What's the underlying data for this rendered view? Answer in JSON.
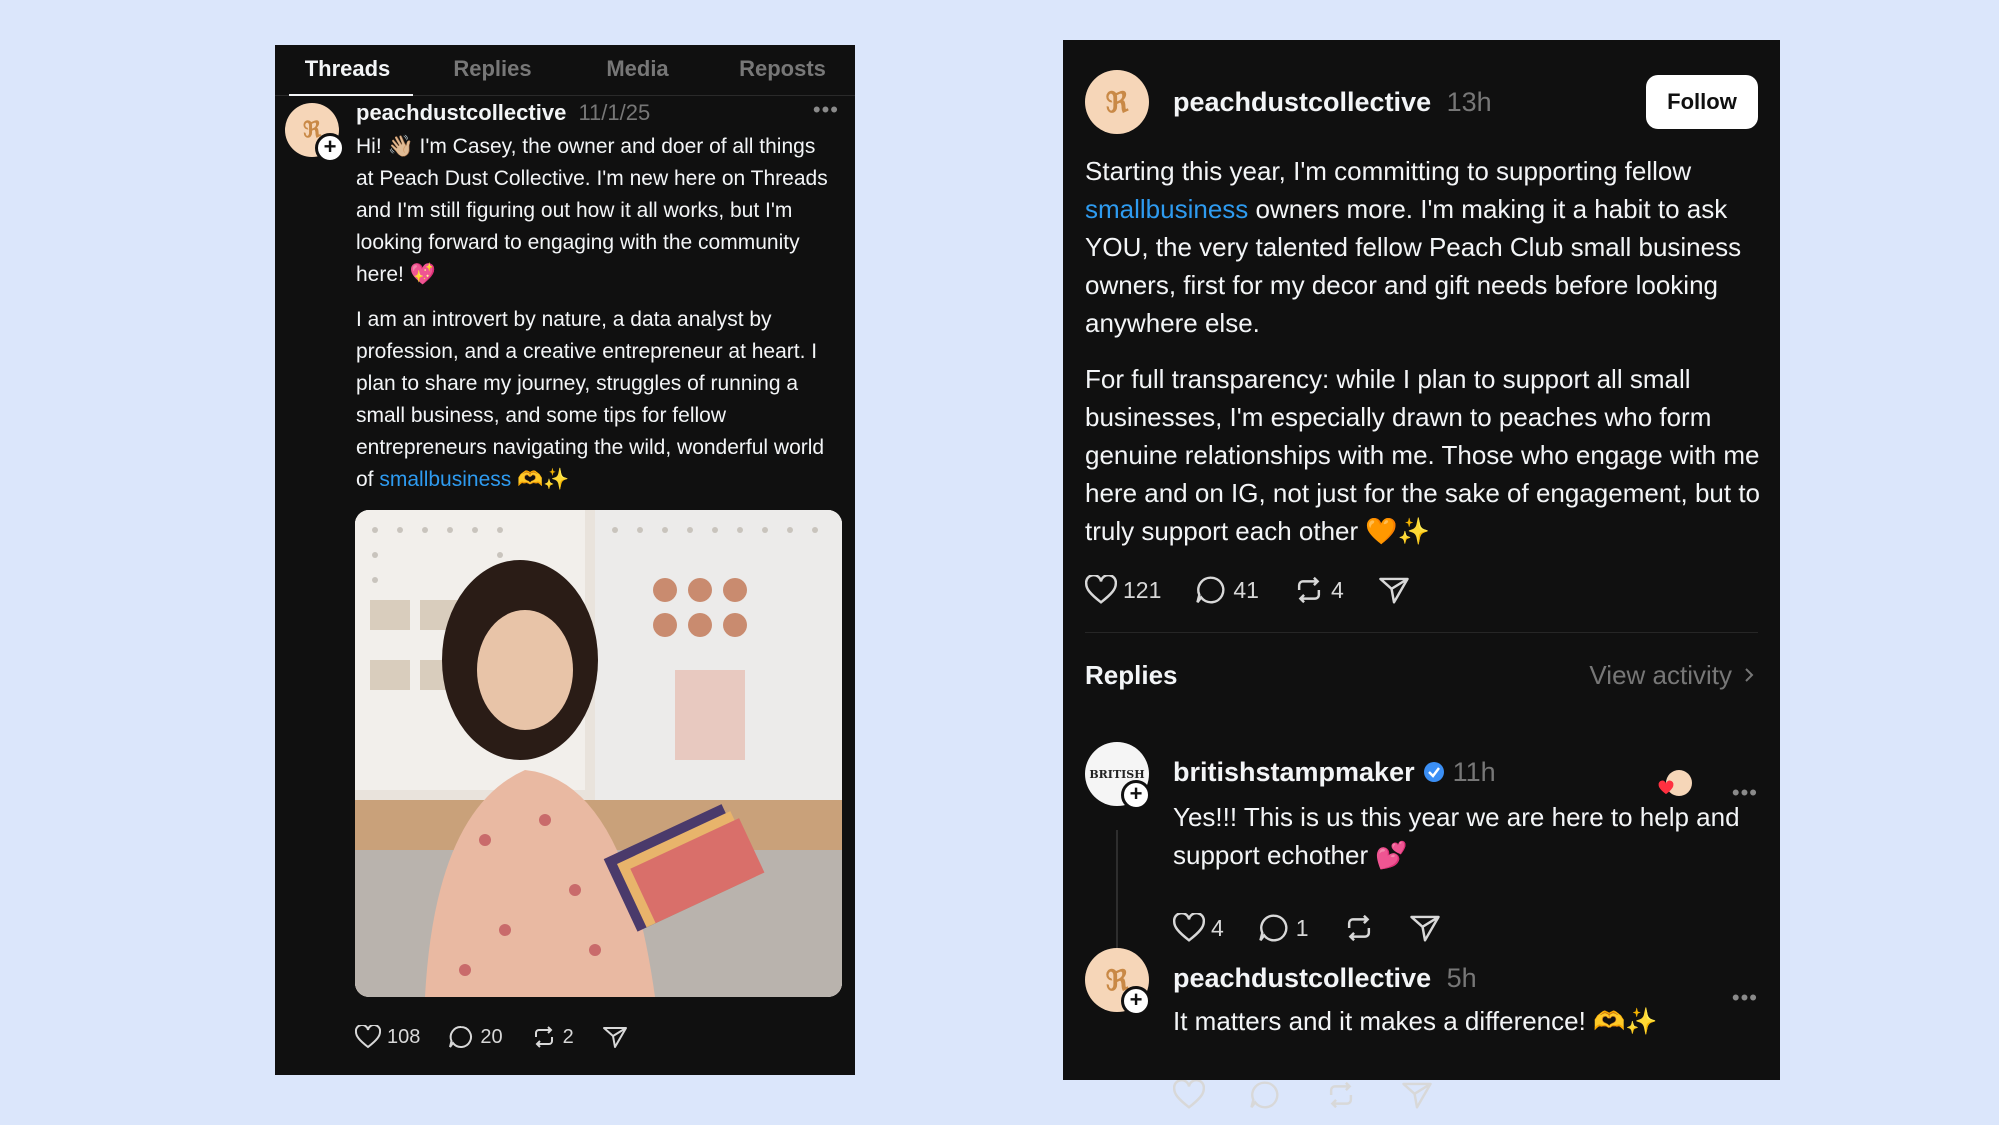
{
  "left": {
    "tabs": [
      "Threads",
      "Replies",
      "Media",
      "Reposts"
    ],
    "post": {
      "username": "peachdustcollective",
      "date": "11/1/25",
      "para1": "Hi! 👋🏼 I'm Casey, the owner and doer of all things at Peach Dust Collective. I'm new here on Threads and I'm still figuring out how it all works, but I'm looking forward to engaging with the community here! 💖",
      "para2_before": "I am an introvert by nature, a data analyst by profession, and a creative entrepreneur at heart. I plan to share my journey, struggles of running a small business, and some tips for fellow entrepreneurs navigating the wild, wonderful world of ",
      "para2_link": "smallbusiness",
      "para2_after": " 🫶✨",
      "likes": "108",
      "comments": "20",
      "reposts": "2"
    }
  },
  "right": {
    "post": {
      "username": "peachdustcollective",
      "time": "13h",
      "follow_label": "Follow",
      "para1_before": "Starting this year, I'm committing to supporting fellow ",
      "para1_link": "smallbusiness",
      "para1_after": " owners more. I'm making it a habit to ask YOU, the very talented fellow Peach Club small business owners, first for my decor and gift needs before looking anywhere else.",
      "para2": "For full transparency: while I plan to support all small businesses, I'm especially drawn to peaches who form genuine relationships with me. Those who engage with me here and on IG, not just for the sake of engagement, but to truly support each other 🧡✨",
      "likes": "121",
      "comments": "41",
      "reposts": "4"
    },
    "replies_header": "Replies",
    "view_activity": "View activity",
    "replies": [
      {
        "username": "britishstampmaker",
        "time": "11h",
        "text": "Yes!!! This is us this year we are here to help and support echother 💕",
        "likes": "4",
        "comments": "1"
      },
      {
        "username": "peachdustcollective",
        "time": "5h",
        "text": "It matters and it makes a difference! 🫶✨"
      }
    ],
    "avatar_mark": "BRITISH"
  },
  "colors": {
    "background": "#dbe6fb",
    "panel": "#101010",
    "link": "#2e9bf0",
    "verified": "#3b8ff5"
  }
}
